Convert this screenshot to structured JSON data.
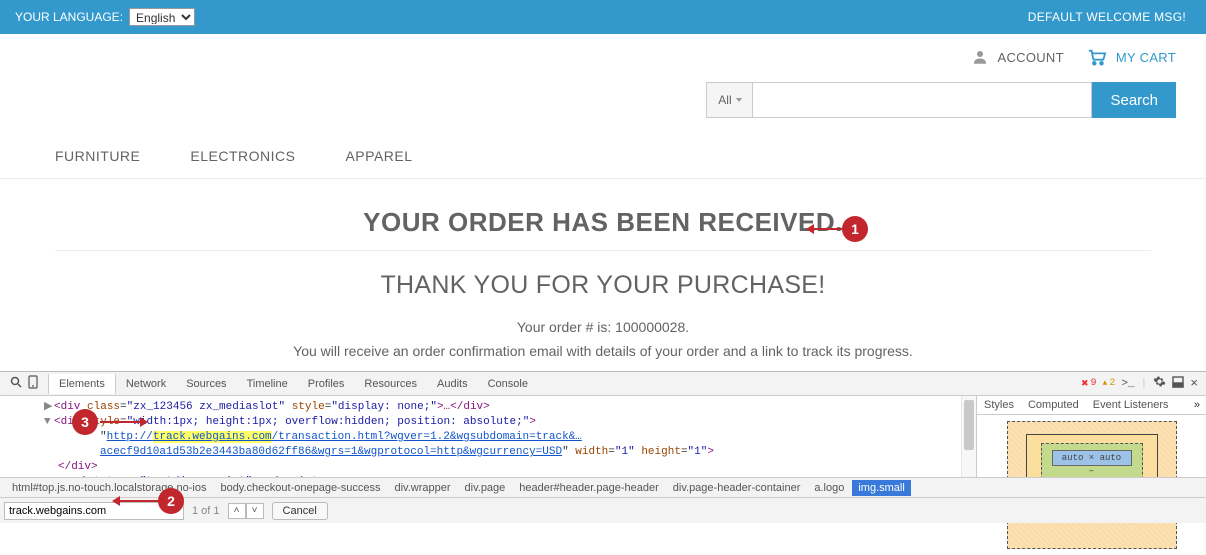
{
  "topbar": {
    "yourLanguage": "YOUR LANGUAGE:",
    "langValue": "English",
    "welcome": "DEFAULT WELCOME MSG!"
  },
  "header": {
    "account": "ACCOUNT",
    "cart": "MY CART"
  },
  "search": {
    "allLabel": "All",
    "btn": "Search"
  },
  "nav": {
    "items": [
      "FURNITURE",
      "ELECTRONICS",
      "APPAREL"
    ]
  },
  "content": {
    "received": "YOUR ORDER HAS BEEN RECEIVED.",
    "thanks": "THANK YOU FOR YOUR PURCHASE!",
    "orderNum": "Your order # is: 100000028.",
    "info": "You will receive an order confirmation email with details of your order and a link to track its progress."
  },
  "annotations": {
    "b1": "1",
    "b2": "2",
    "b3": "3"
  },
  "devtools": {
    "tabs": [
      "Elements",
      "Network",
      "Sources",
      "Timeline",
      "Profiles",
      "Resources",
      "Audits",
      "Console"
    ],
    "errCount": "9",
    "warnCount": "2",
    "sideTabs": [
      "Styles",
      "Computed",
      "Event Listeners"
    ],
    "boxContent": "auto × auto",
    "dom": {
      "l1a": "<div ",
      "l1cls": "class",
      "l1clsv": "\"zx_123456 zx_mediaslot\"",
      "l1sty": "style",
      "l1styv": "\"display: none;\"",
      "l1b": ">…</div>",
      "l2a": "<",
      "l2tag": "div ",
      "l2sty": "style",
      "l2styv": "\"width:1px; height:1px; overflow:hidden; position: absolute;\"",
      "l2b": ">",
      "l3pre": "\"",
      "l3host": "track.webgains.com",
      "l3url1": "http://",
      "l3url2": "/transaction.html?wgver=1.2&wgsubdomain=track&…",
      "l4": "acecf9d10a1d53b2e3443ba80d62ff86&wgrs=1&wgprotocol=http&wgcurrency=USD",
      "l4post": "\" ",
      "l4w": "width",
      "l4wv": "\"1\"",
      "l4h": "height",
      "l4hv": "\"1\"",
      "l4end": ">",
      "l5a": "</div>",
      "l6a": "<script ",
      "l6t": "type",
      "l6tv": "\"text/javascript\"",
      "l6b": ">…</scr",
      "l6c": "ipt>"
    },
    "crumbs": [
      "html#top.js.no-touch.localstorage.no-ios",
      "body.checkout-onepage-success",
      "div.wrapper",
      "div.page",
      "header#header.page-header",
      "div.page-header-container",
      "a.logo",
      "img.small"
    ],
    "find": {
      "value": "track.webgains.com",
      "count": "1 of 1",
      "cancel": "Cancel"
    }
  }
}
